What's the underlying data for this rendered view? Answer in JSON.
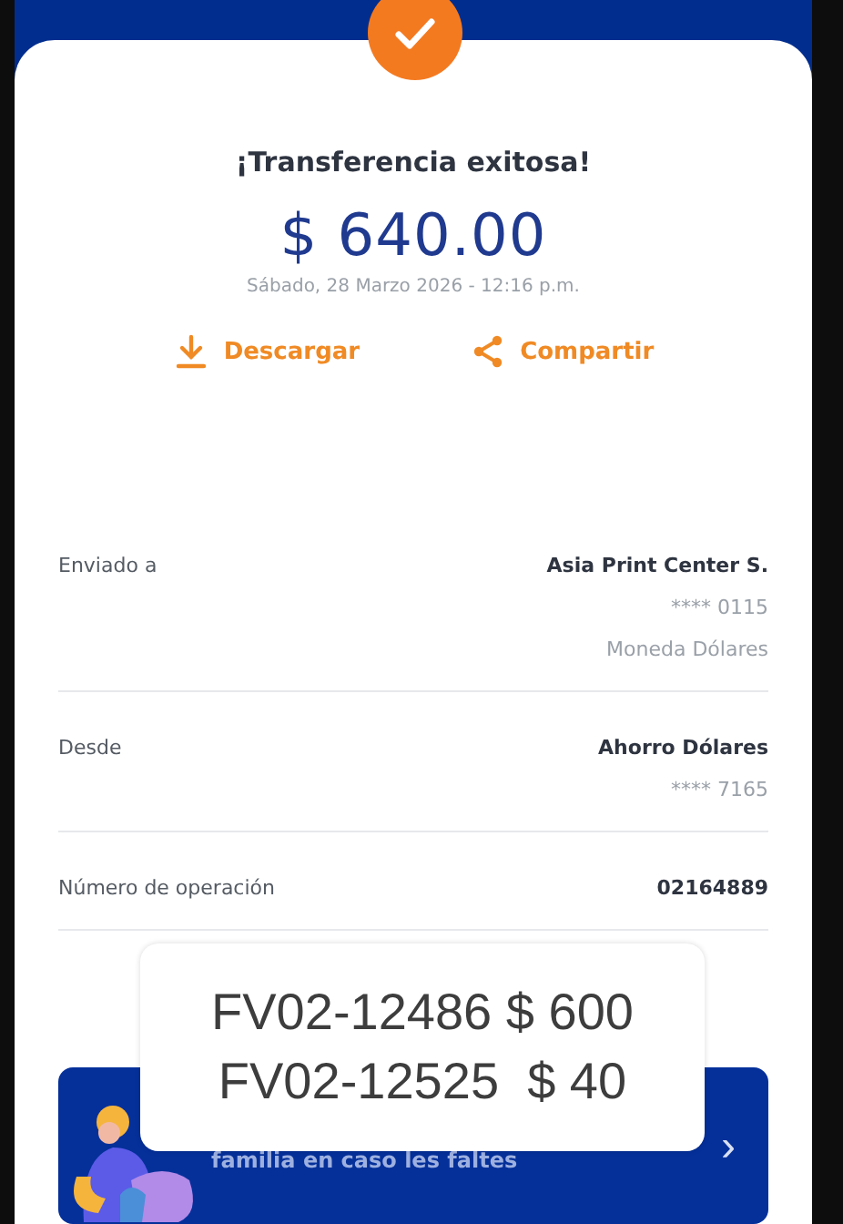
{
  "receipt": {
    "title": "¡Transferencia exitosa!",
    "amount": "$ 640.00",
    "datetime": "Sábado, 28 Marzo 2026 - 12:16 p.m.",
    "actions": [
      {
        "kind": "download",
        "label": "Descargar"
      },
      {
        "kind": "share",
        "label": "Compartir"
      }
    ],
    "details": [
      {
        "label": "Enviado a",
        "values": [
          "Asia Print Center S.",
          "**** 0115",
          "Moneda Dólares"
        ]
      },
      {
        "label": "Desde",
        "values": [
          "Ahorro Dólares",
          "**** 7165"
        ]
      },
      {
        "label": "Número de operación",
        "values": [
          "02164889"
        ]
      }
    ]
  },
  "banner": {
    "text": "familia en caso les faltes",
    "chevron": "›"
  },
  "note": {
    "lines": [
      "FV02-12486 $ 600",
      "FV02-12525  $ 40"
    ]
  }
}
